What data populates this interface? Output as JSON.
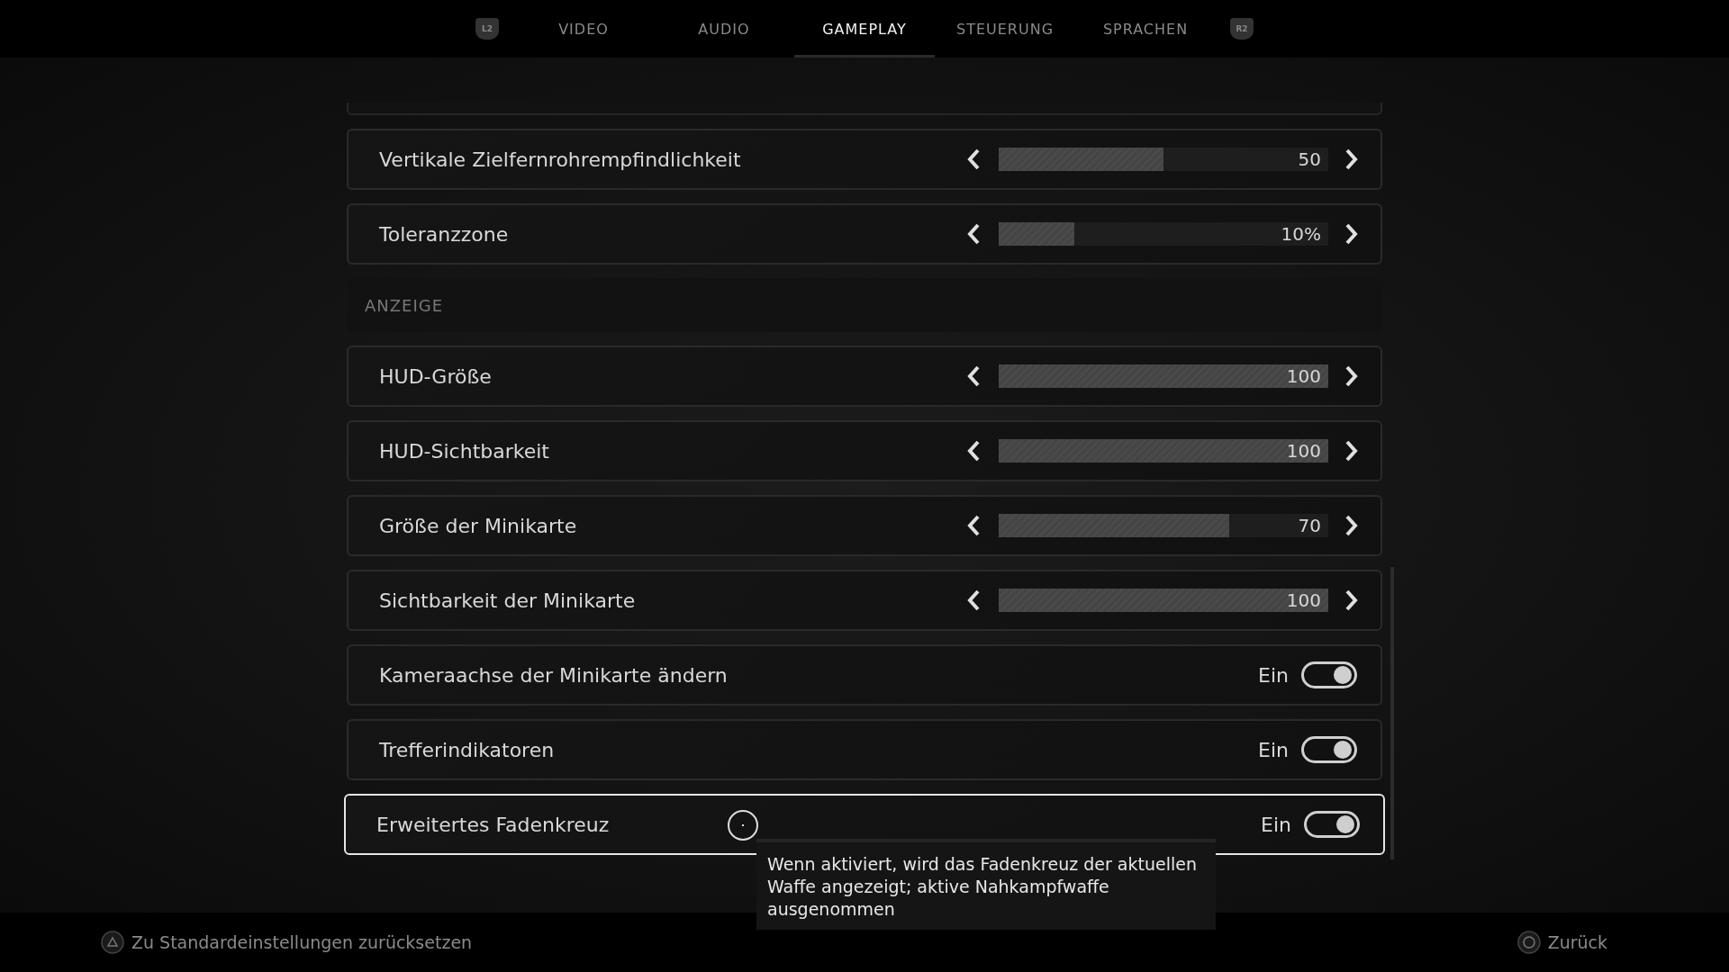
{
  "tabs": {
    "prev_key": "L2",
    "next_key": "R2",
    "items": [
      {
        "label": "VIDEO",
        "selected": false
      },
      {
        "label": "AUDIO",
        "selected": false
      },
      {
        "label": "GAMEPLAY",
        "selected": true
      },
      {
        "label": "STEUERUNG",
        "selected": false
      },
      {
        "label": "SPRACHEN",
        "selected": false
      }
    ]
  },
  "settings": [
    {
      "kind": "slider",
      "label": "Vertikale Zielfernrohrempfindlichkeit",
      "level": 0.5,
      "reading": "50",
      "selected": false
    },
    {
      "kind": "slider",
      "label": "Toleranzzone",
      "level": 0.23,
      "reading": "10%",
      "selected": false
    },
    {
      "kind": "header",
      "label": "ANZEIGE"
    },
    {
      "kind": "slider",
      "label": "HUD-Größe",
      "level": 1,
      "reading": "100",
      "selected": false
    },
    {
      "kind": "slider",
      "label": "HUD-Sichtbarkeit",
      "level": 1,
      "reading": "100",
      "selected": false
    },
    {
      "kind": "slider",
      "label": "Größe der Minikarte",
      "level": 0.7,
      "reading": "70",
      "selected": false
    },
    {
      "kind": "slider",
      "label": "Sichtbarkeit der Minikarte",
      "level": 1,
      "reading": "100",
      "selected": false
    },
    {
      "kind": "toggle",
      "label": "Kameraachse der Minikarte ändern",
      "on": true,
      "value": "Ein",
      "selected": false
    },
    {
      "kind": "toggle",
      "label": "Trefferindikatoren",
      "on": true,
      "value": "Ein",
      "selected": false
    },
    {
      "kind": "toggle",
      "label": "Erweitertes Fadenkreuz",
      "on": true,
      "value": "Ein",
      "selected": true,
      "tooltip": "Wenn aktiviert, wird das Fadenkreuz der aktuellen Waffe angezeigt; aktive Nahkampfwaffe ausgenommen"
    }
  ],
  "footer": {
    "reset": "Zu Standardeinstellungen zurücksetzen",
    "back": "Zurück"
  }
}
